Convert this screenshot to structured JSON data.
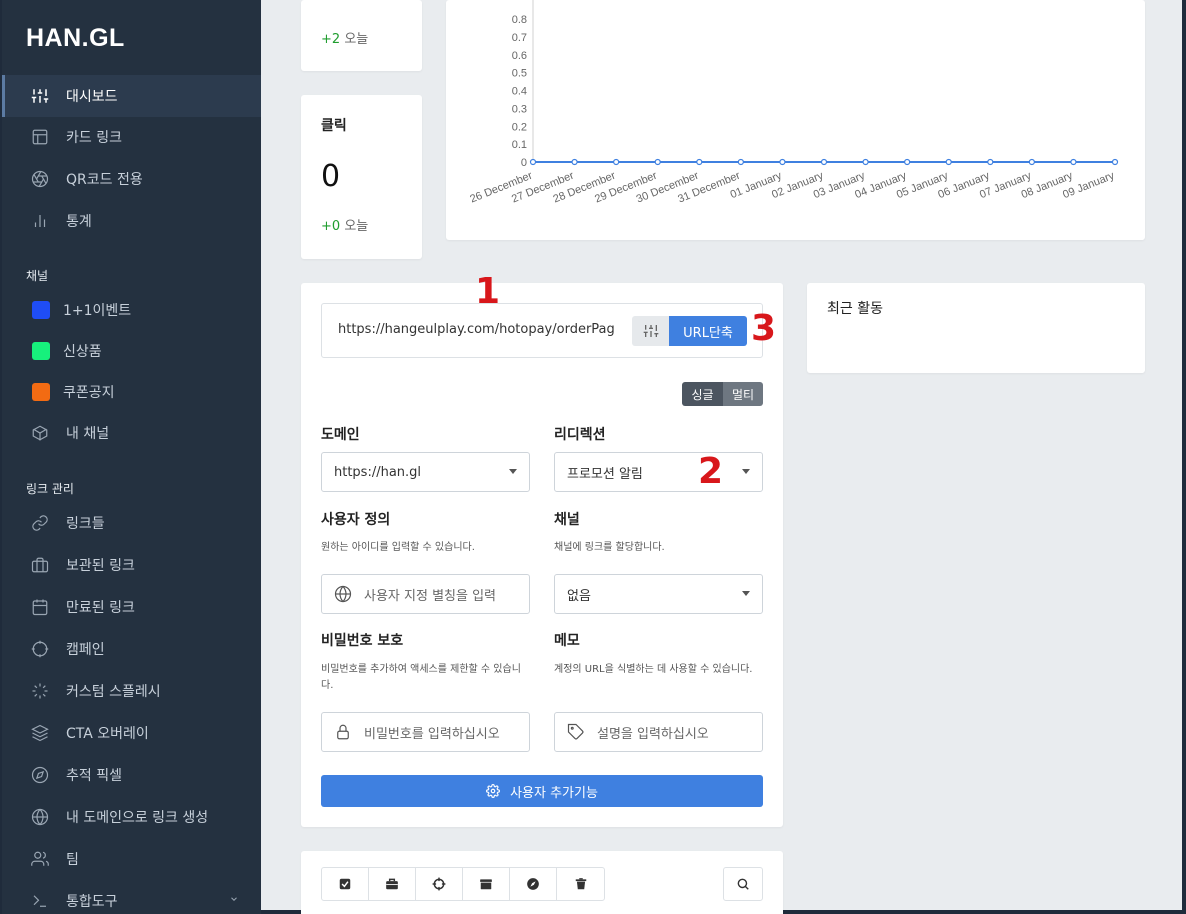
{
  "app": {
    "logo": "HAN.GL"
  },
  "sidebar": {
    "main_items": [
      {
        "label": "대시보드",
        "icon": "sliders-icon",
        "active": true
      },
      {
        "label": "카드 링크",
        "icon": "layout-icon"
      },
      {
        "label": "QR코드 전용",
        "icon": "aperture-icon"
      },
      {
        "label": "통계",
        "icon": "bar-chart-icon"
      }
    ],
    "channels_title": "채널",
    "channels": [
      {
        "label": "1+1이벤트",
        "color": "#1f4df5"
      },
      {
        "label": "신상품",
        "color": "#17f07c"
      },
      {
        "label": "쿠폰공지",
        "color": "#f26b13"
      },
      {
        "label": "내 채널",
        "icon": "cube-icon"
      }
    ],
    "links_title": "링크 관리",
    "link_items": [
      {
        "label": "링크들",
        "icon": "link-icon"
      },
      {
        "label": "보관된 링크",
        "icon": "archive-icon"
      },
      {
        "label": "만료된 링크",
        "icon": "calendar-icon"
      },
      {
        "label": "캠페인",
        "icon": "crosshair-icon"
      },
      {
        "label": "커스텀 스플레시",
        "icon": "loader-icon"
      },
      {
        "label": "CTA 오버레이",
        "icon": "layers-icon"
      },
      {
        "label": "추적 픽셀",
        "icon": "compass-icon"
      },
      {
        "label": "내 도메인으로 링크 생성",
        "icon": "globe-icon"
      },
      {
        "label": "팀",
        "icon": "users-icon"
      },
      {
        "label": "통합도구",
        "icon": "terminal-icon"
      }
    ]
  },
  "stats": {
    "top_card": {
      "today_delta": "+2",
      "today_label": "오늘"
    },
    "clicks_card": {
      "title": "클릭",
      "value": "0",
      "today_delta": "+0",
      "today_label": "오늘"
    }
  },
  "chart_data": {
    "type": "line",
    "x": [
      "26 December",
      "27 December",
      "28 December",
      "29 December",
      "30 December",
      "31 December",
      "01 January",
      "02 January",
      "03 January",
      "04 January",
      "05 January",
      "06 January",
      "07 January",
      "08 January",
      "09 January"
    ],
    "series": [
      {
        "values": [
          0,
          0,
          0,
          0,
          0,
          0,
          0,
          0,
          0,
          0,
          0,
          0,
          0,
          0,
          0
        ],
        "color": "#3f80e0"
      }
    ],
    "yticks": [
      "0.8",
      "0.7",
      "0.6",
      "0.5",
      "0.4",
      "0.3",
      "0.2",
      "0.1",
      "0"
    ],
    "ylim": [
      0,
      0.8
    ],
    "grid": false
  },
  "shortener": {
    "url_value": "https://hangeulplay.com/hotopay/orderPag",
    "shorten_label": "URL단축",
    "toggle_single": "싱글",
    "toggle_multi": "멀티",
    "domain_label": "도메인",
    "domain_value": "https://han.gl",
    "redirect_label": "리디렉션",
    "redirect_value": "프로모션 알림",
    "alias_label": "사용자 정의",
    "alias_desc": "원하는 아이디를 입력할 수 있습니다.",
    "alias_placeholder": "사용자 지정 별칭을 입력",
    "channel_label": "채널",
    "channel_desc": "채널에 링크를 할당합니다.",
    "channel_value": "없음",
    "password_label": "비밀번호 보호",
    "password_desc": "비밀번호를 추가하여 액세스를 제한할 수 있습니다.",
    "password_placeholder": "비밀번호를 입력하십시오",
    "memo_label": "메모",
    "memo_desc": "계정의 URL을 식별하는 데 사용할 수 있습니다.",
    "memo_placeholder": "설명을 입력하십시오",
    "advanced_label": "사용자 추가기능"
  },
  "recent": {
    "title": "최근 활동"
  },
  "annotations": [
    "1",
    "2",
    "3"
  ],
  "colors": {
    "accent": "#3f80e0",
    "sidebar": "#243140",
    "annotation": "#d8171b"
  }
}
